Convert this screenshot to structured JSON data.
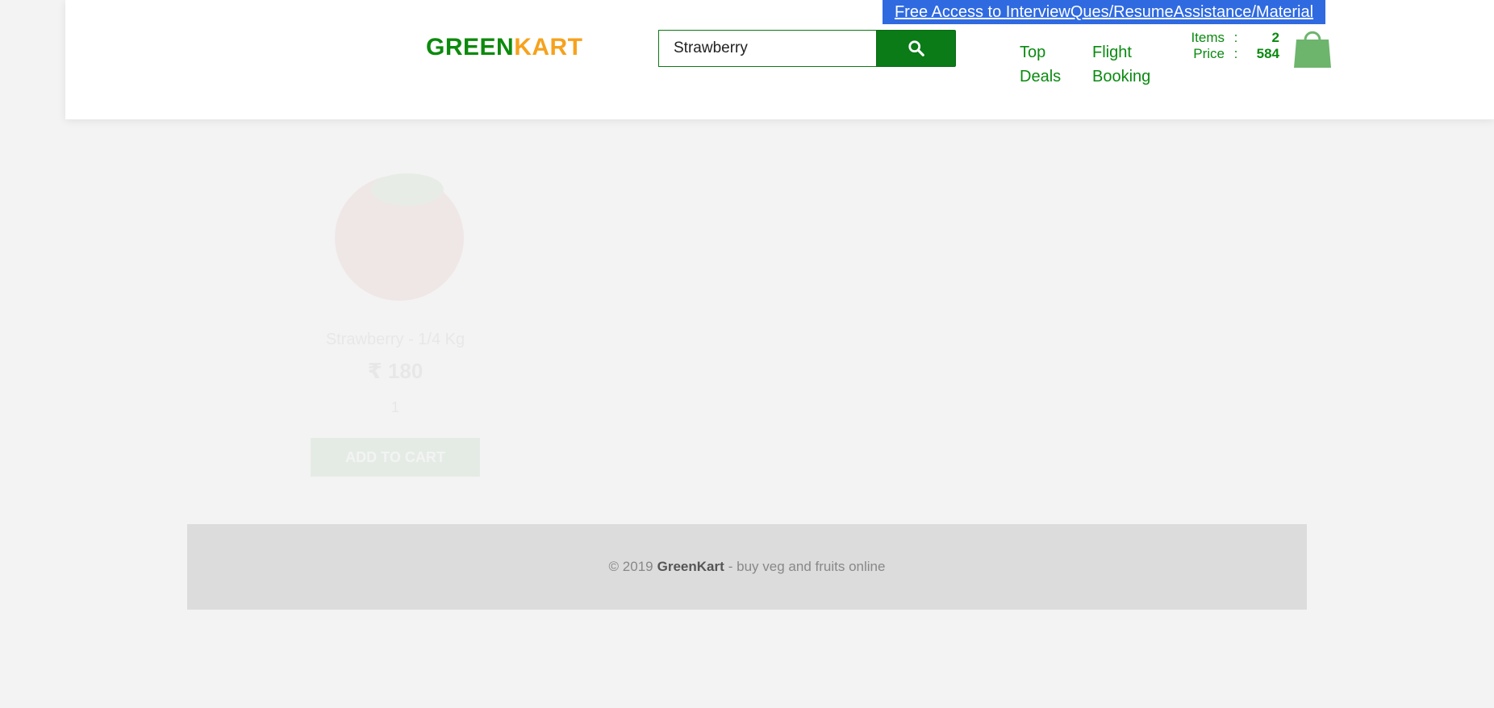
{
  "promo": {
    "link_text": "Free Access to InterviewQues/ResumeAssistance/Material"
  },
  "brand": {
    "part1": "GREEN",
    "part2": "KART"
  },
  "search": {
    "value": "Strawberry",
    "button_icon": "search-icon"
  },
  "nav": {
    "top_deals_line1": "Top",
    "top_deals_line2": "Deals",
    "flight_line1": "Flight",
    "flight_line2": "Booking"
  },
  "cart": {
    "items_label": "Items",
    "items_value": "2",
    "price_label": "Price",
    "price_value": "584",
    "separator": ":",
    "icon": "shopping-bag-icon"
  },
  "product": {
    "name": "Strawberry - 1/4 Kg",
    "price": "₹ 180",
    "quantity": "1",
    "add_label": "ADD TO CART"
  },
  "footer": {
    "prefix": "© 2019",
    "brand": "GreenKart",
    "suffix": "- buy veg and fruits online"
  },
  "colors": {
    "brand_green": "#0c8a0c",
    "brand_orange": "#f6a21d",
    "promo_blue": "#2f6ae0",
    "button_green": "#0a7b17",
    "cart_bag": "#6db56d"
  }
}
